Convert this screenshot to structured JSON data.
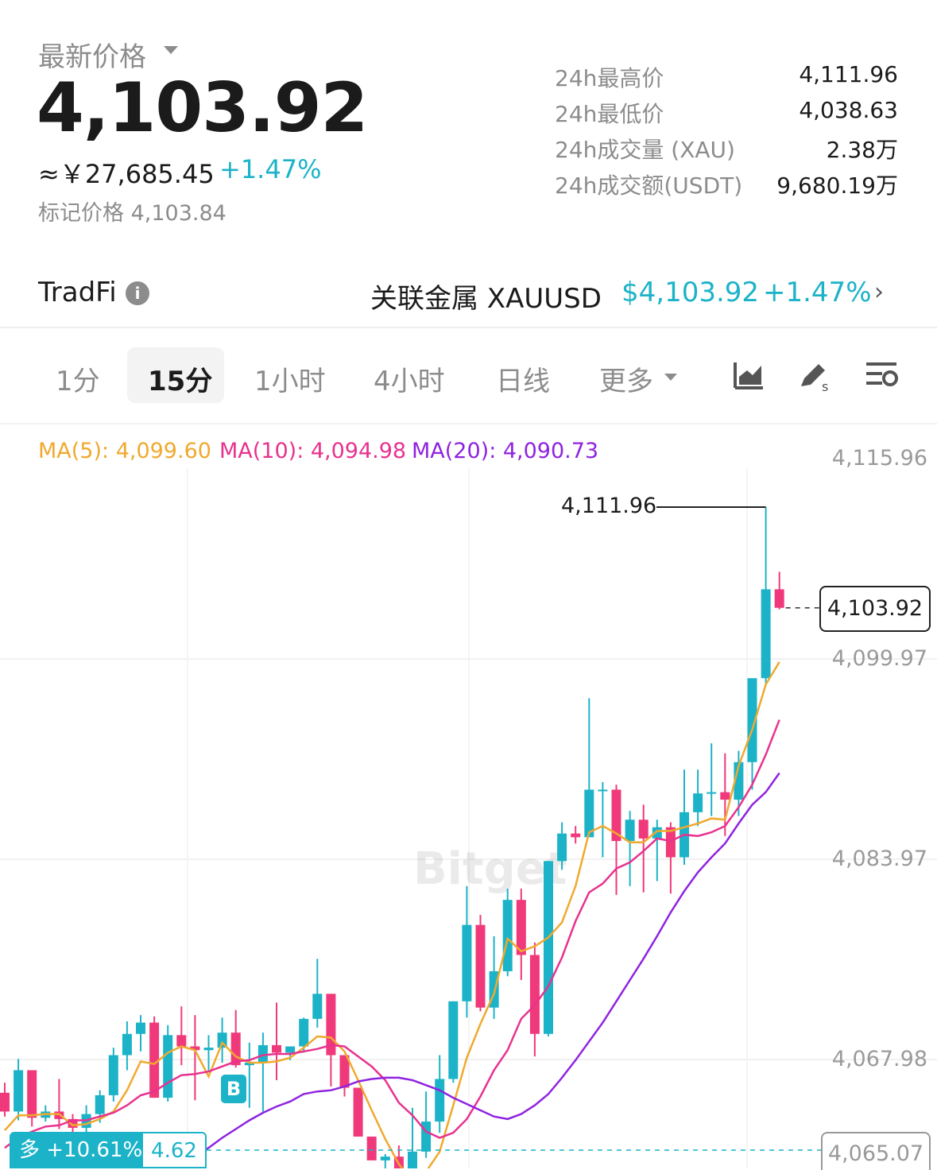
{
  "header": {
    "price_label": "最新价格",
    "last_price": "4,103.92",
    "cny_price": "≈￥27,685.45",
    "change": "+1.47%",
    "mark_price": "标记价格 4,103.84"
  },
  "stats": [
    {
      "label": "24h最高价",
      "value": "4,111.96"
    },
    {
      "label": "24h最低价",
      "value": "4,038.63"
    },
    {
      "label": "24h成交量 (XAU)",
      "value": "2.38万"
    },
    {
      "label": "24h成交额(USDT)",
      "value": "9,680.19万"
    }
  ],
  "tradfi": {
    "label": "TradFi",
    "related_name": "关联金属  XAUUSD",
    "related_price": "$4,103.92",
    "related_change": "+1.47%"
  },
  "tabs": {
    "t1": "1分",
    "t15": "15分",
    "t1h": "1小时",
    "t4h": "4小时",
    "tday": "日线",
    "more": "更多"
  },
  "icons": [
    "area-chart-icon",
    "draw-tool-icon",
    "indicator-settings-icon",
    "info-icon",
    "chevron-right-icon"
  ],
  "colors": {
    "up": "#1cb3c8",
    "down": "#f0397a",
    "ma5": "#f0a92e",
    "ma10": "#e8328f",
    "ma20": "#8f23e0"
  },
  "chart_data": {
    "type": "candlestick",
    "interval": "15分",
    "ma_labels": {
      "ma5": "MA(5): 4,099.60",
      "ma10": "MA(10): 4,094.98",
      "ma20": "MA(20): 4,090.73"
    },
    "y_ticks": [
      "4,115.96",
      "4,099.97",
      "4,083.97",
      "4,067.98"
    ],
    "y_tick_values": [
      4115.96,
      4099.97,
      4083.97,
      4067.98
    ],
    "high_label": "4,111.96",
    "high_value": 4111.96,
    "last_price_label": "4,103.92",
    "last_price_value": 4103.92,
    "position_side": "多 +10.61%",
    "position_amount": "4.62",
    "buy_marker": "B",
    "candles": [
      [
        4065.2,
        4066.0,
        4063.3,
        4063.7
      ],
      [
        4063.7,
        4067.9,
        4063.0,
        4067.0
      ],
      [
        4067.0,
        4067.0,
        4062.5,
        4063.2
      ],
      [
        4063.2,
        4064.2,
        4062.9,
        4063.7
      ],
      [
        4063.7,
        4066.3,
        4062.3,
        4063.1
      ],
      [
        4063.1,
        4063.5,
        4061.9,
        4062.4
      ],
      [
        4062.4,
        4064.2,
        4062.0,
        4063.5
      ],
      [
        4063.5,
        4065.4,
        4062.8,
        4065.0
      ],
      [
        4065.0,
        4068.8,
        4064.5,
        4068.2
      ],
      [
        4068.2,
        4070.9,
        4067.0,
        4069.9
      ],
      [
        4069.9,
        4071.4,
        4068.5,
        4070.8
      ],
      [
        4070.8,
        4071.3,
        4064.8,
        4064.8
      ],
      [
        4064.8,
        4070.6,
        4064.5,
        4069.8
      ],
      [
        4069.8,
        4072.1,
        4067.4,
        4068.9
      ],
      [
        4068.9,
        4071.4,
        4064.6,
        4068.6
      ],
      [
        4068.6,
        4069.8,
        4067.0,
        4068.8
      ],
      [
        4068.8,
        4071.2,
        4067.6,
        4070.0
      ],
      [
        4070.0,
        4071.8,
        4067.2,
        4067.4
      ],
      [
        4067.4,
        4069.2,
        4064.0,
        4067.6
      ],
      [
        4067.6,
        4070.0,
        4063.7,
        4069.0
      ],
      [
        4069.0,
        4072.4,
        4066.2,
        4068.4
      ],
      [
        4068.4,
        4068.9,
        4067.8,
        4068.9
      ],
      [
        4068.9,
        4071.2,
        4068.4,
        4071.1
      ],
      [
        4071.1,
        4075.9,
        4070.4,
        4073.1
      ],
      [
        4073.1,
        4073.1,
        4065.7,
        4068.2
      ],
      [
        4068.2,
        4068.2,
        4064.9,
        4065.6
      ],
      [
        4065.6,
        4065.6,
        4061.7,
        4061.7
      ],
      [
        4061.7,
        4061.7,
        4059.8,
        4059.8
      ],
      [
        4059.8,
        4060.3,
        4058.4,
        4060.1
      ],
      [
        4060.1,
        4061.0,
        4058.0,
        4059.0
      ],
      [
        4059.0,
        4064.0,
        4058.3,
        4060.5
      ],
      [
        4060.5,
        4065.3,
        4060.0,
        4062.9
      ],
      [
        4062.9,
        4068.2,
        4062.0,
        4066.3
      ],
      [
        4066.3,
        4072.5,
        4066.0,
        4072.5
      ],
      [
        4072.5,
        4081.7,
        4071.2,
        4078.6
      ],
      [
        4078.6,
        4079.4,
        4071.7,
        4072.0
      ],
      [
        4072.0,
        4077.7,
        4071.1,
        4074.9
      ],
      [
        4074.9,
        4081.5,
        4074.5,
        4080.6
      ],
      [
        4080.6,
        4081.5,
        4074.2,
        4076.2
      ],
      [
        4076.2,
        4077.2,
        4068.1,
        4069.9
      ],
      [
        4069.9,
        4083.7,
        4069.7,
        4083.7
      ],
      [
        4083.7,
        4086.8,
        4083.0,
        4085.9
      ],
      [
        4085.9,
        4086.5,
        4085.1,
        4085.6
      ],
      [
        4085.6,
        4096.7,
        4086.4,
        4089.4
      ],
      [
        4089.4,
        4090.0,
        4084.0,
        4089.4
      ],
      [
        4089.4,
        4089.8,
        4081.0,
        4085.3
      ],
      [
        4085.3,
        4087.7,
        4081.7,
        4087.0
      ],
      [
        4087.0,
        4088.2,
        4081.2,
        4085.5
      ],
      [
        4085.5,
        4087.0,
        4082.1,
        4086.4
      ],
      [
        4086.4,
        4086.8,
        4081.1,
        4084.0
      ],
      [
        4084.0,
        4091.0,
        4083.4,
        4087.6
      ],
      [
        4087.6,
        4091.0,
        4086.5,
        4089.1
      ],
      [
        4089.1,
        4093.1,
        4087.3,
        4089.2
      ],
      [
        4089.2,
        4092.3,
        4085.7,
        4088.6
      ],
      [
        4088.6,
        4092.5,
        4087.3,
        4091.6
      ],
      [
        4091.6,
        4095.1,
        4089.4,
        4098.3
      ],
      [
        4098.3,
        4111.96,
        4097.9,
        4105.4
      ],
      [
        4105.4,
        4106.8,
        4103.8,
        4103.92
      ]
    ],
    "ma5": [
      4062.2,
      4063.4,
      4063.4,
      4063.5,
      4063.5,
      4062.6,
      4062.7,
      4063.1,
      4063.7,
      4065.4,
      4067.7,
      4067.5,
      4068.4,
      4068.9,
      4068.6,
      4066.5,
      4069.2,
      4068.1,
      4067.6,
      4067.6,
      4067.7,
      4068.0,
      4068.8,
      4069.7,
      4069.6,
      4068.5,
      4066.2,
      4063.8,
      4061.5,
      4059.5,
      4058.1,
      4058.9,
      4060.5,
      4064.2,
      4068.0,
      4070.7,
      4073.1,
      4077.5,
      4076.5,
      4076.9,
      4077.6,
      4078.8,
      4081.7,
      4086.0,
      4086.5,
      4085.9,
      4085.2,
      4085.2,
      4086.1,
      4086.1,
      4086.4,
      4086.7,
      4087.1,
      4087.0,
      4091.3,
      4094.2,
      4097.8,
      4099.6
    ],
    "ma10": [
      4060.8,
      4061.6,
      4062.1,
      4062.5,
      4062.6,
      4063.0,
      4063.0,
      4063.3,
      4063.6,
      4064.2,
      4065.0,
      4065.3,
      4066.0,
      4066.6,
      4066.7,
      4066.9,
      4067.3,
      4067.7,
      4067.8,
      4068.2,
      4068.3,
      4068.3,
      4068.5,
      4068.7,
      4069.0,
      4068.9,
      4068.1,
      4067.3,
      4066.2,
      4064.4,
      4063.4,
      4062.1,
      4061.6,
      4062.0,
      4063.1,
      4064.9,
      4067.0,
      4068.6,
      4071.1,
      4072.2,
      4073.7,
      4076.0,
      4078.9,
      4081.2,
      4081.9,
      4083.1,
      4083.6,
      4084.5,
      4085.5,
      4085.3,
      4085.8,
      4085.7,
      4086.0,
      4086.5,
      4088.0,
      4089.8,
      4092.2,
      4094.98
    ],
    "ma20": [
      4056.7,
      4057.3,
      4058.0,
      4058.8,
      4059.3,
      4060.1,
      4060.8,
      4061.6,
      4062.3,
      4063.0,
      4063.6,
      4064.1,
      4064.5,
      4065.1,
      4065.3,
      4065.4,
      4065.7,
      4066.1,
      4066.3,
      4066.4,
      4066.4,
      4066.2,
      4065.8,
      4065.4,
      4064.8,
      4064.3,
      4063.8,
      4063.3,
      4063.1,
      4063.5,
      4064.2,
      4065.1,
      4066.4,
      4067.8,
      4069.3,
      4070.8,
      4072.5,
      4074.2,
      4075.9,
      4077.7,
      4079.6,
      4081.3,
      4082.8,
      4084.0,
      4085.1,
      4086.7,
      4088.2,
      4089.2,
      4090.73
    ]
  }
}
